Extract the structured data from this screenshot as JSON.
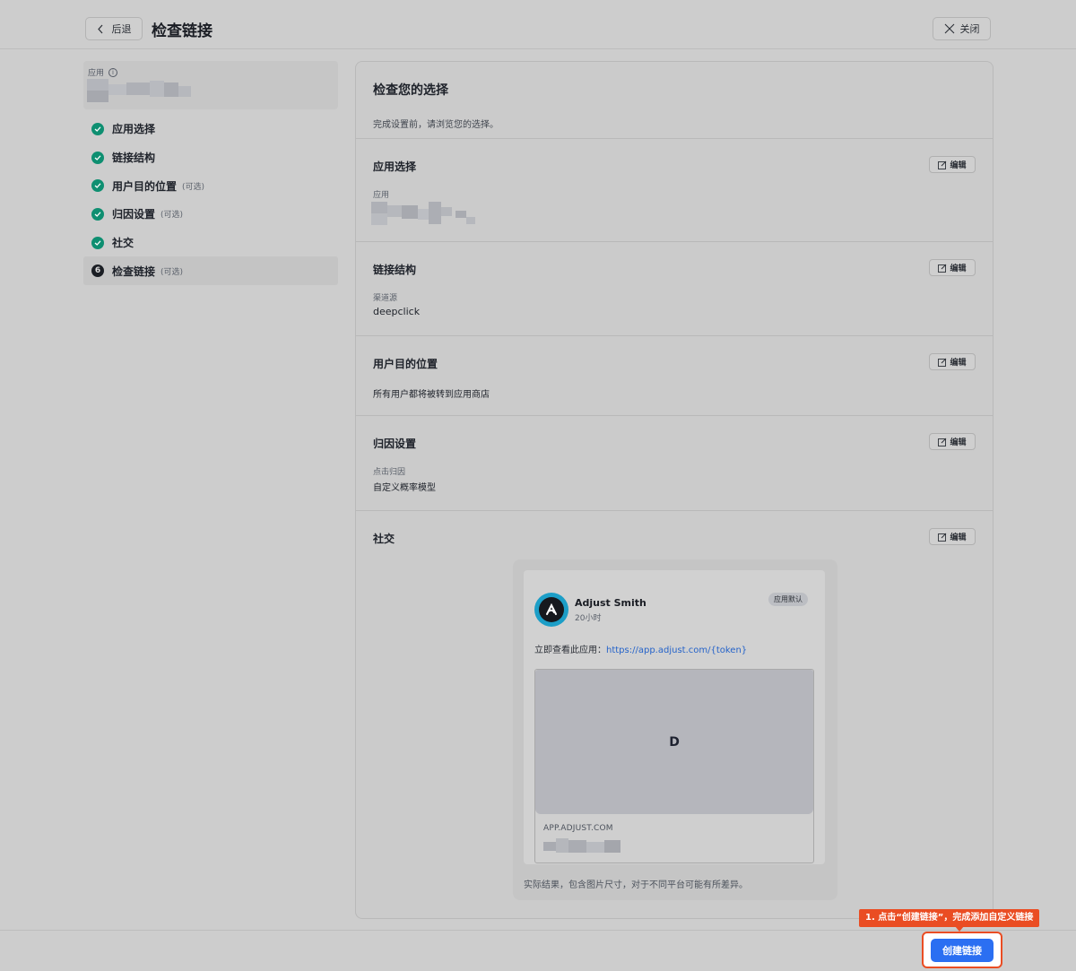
{
  "header": {
    "back_label": "后退",
    "title": "检查链接",
    "close_label": "关闭"
  },
  "sidebar": {
    "app_label": "应用",
    "steps": [
      {
        "label": "应用选择",
        "optional": "",
        "status": "done"
      },
      {
        "label": "链接结构",
        "optional": "",
        "status": "done"
      },
      {
        "label": "用户目的位置",
        "optional": "(可选)",
        "status": "done"
      },
      {
        "label": "归因设置",
        "optional": "(可选)",
        "status": "done"
      },
      {
        "label": "社交",
        "optional": "",
        "status": "done"
      },
      {
        "label": "检查链接",
        "optional": "(可选)",
        "status": "current",
        "number": "6"
      }
    ]
  },
  "review": {
    "title": "检查您的选择",
    "subtitle": "完成设置前，请浏览您的选择。",
    "edit_label": "编辑",
    "sections": {
      "app": {
        "title": "应用选择",
        "field_label": "应用"
      },
      "structure": {
        "title": "链接结构",
        "field_label": "渠道源",
        "value": "deepclick"
      },
      "destination": {
        "title": "用户目的位置",
        "value": "所有用户都将被转到应用商店"
      },
      "attribution": {
        "title": "归因设置",
        "field_label": "点击归因",
        "value": "自定义概率模型"
      },
      "social": {
        "title": "社交"
      }
    }
  },
  "social_preview": {
    "user_name": "Adjust Smith",
    "time": "20小时",
    "badge": "应用默认",
    "text_prefix": "立即查看此应用：",
    "link": "https://app.adjust.com/{token}",
    "image_letter": "D",
    "domain": "APP.ADJUST.COM",
    "disclaimer": "实际结果，包含图片尺寸，对于不同平台可能有所差异。",
    "avatar_color": "#1c9ec7"
  },
  "footer": {
    "callout": "1. 点击“创建链接”，完成添加自定义链接",
    "create_label": "创建链接",
    "accent": "#2b6ff2",
    "callout_color": "#ea4d23"
  }
}
